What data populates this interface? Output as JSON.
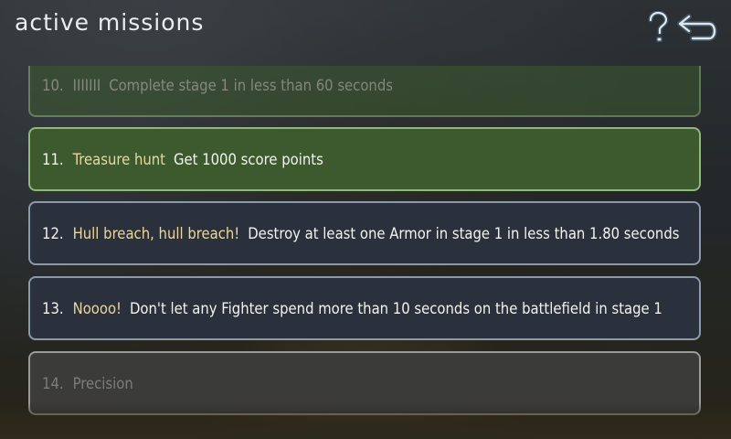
{
  "header": {
    "title": "active missions"
  },
  "missions": [
    {
      "number": "10.",
      "name": "IIIIIII",
      "description": "Complete stage 1 in less than 60 seconds",
      "state": "completed"
    },
    {
      "number": "11.",
      "name": "Treasure hunt",
      "description": "Get 1000 score points",
      "state": "completed"
    },
    {
      "number": "12.",
      "name": "Hull breach, hull breach!",
      "description": "Destroy at least one Armor in stage 1 in less than 1.80 seconds",
      "state": "active"
    },
    {
      "number": "13.",
      "name": "Noooo!",
      "description": "Don't let any Fighter spend more than 10 seconds on the battlefield in stage 1",
      "state": "active"
    },
    {
      "number": "14.",
      "name": "Precision",
      "description": "",
      "state": "locked"
    }
  ],
  "icons": {
    "help": "question-mark-icon",
    "back": "back-arrow-icon"
  },
  "colors": {
    "completed_bg": "#3c5a2e",
    "completed_border": "#8fb87a",
    "active_bg": "#2a313c",
    "active_border": "#8d99aa",
    "locked_bg": "#3b3b3a",
    "mission_name": "#e9d7a2"
  }
}
